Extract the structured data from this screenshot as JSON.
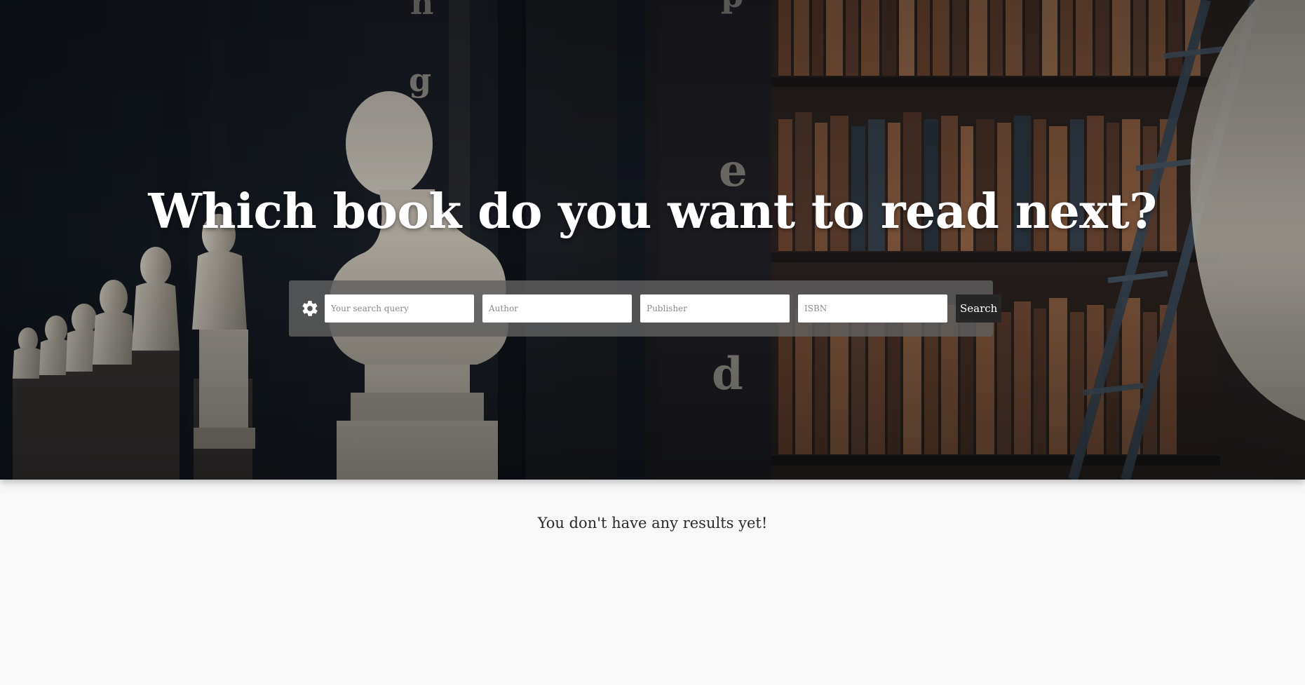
{
  "hero": {
    "title": "Which book do you want to read next?"
  },
  "search": {
    "settings_icon": "gear-icon",
    "query_placeholder": "Your search query",
    "author_placeholder": "Author",
    "publisher_placeholder": "Publisher",
    "isbn_placeholder": "ISBN",
    "button_label": "Search"
  },
  "results": {
    "empty_message": "You don't have any results yet!"
  },
  "colors": {
    "page_background": "#f8f8f8",
    "search_button": "#262626",
    "search_bar": "#5f5f5f"
  }
}
